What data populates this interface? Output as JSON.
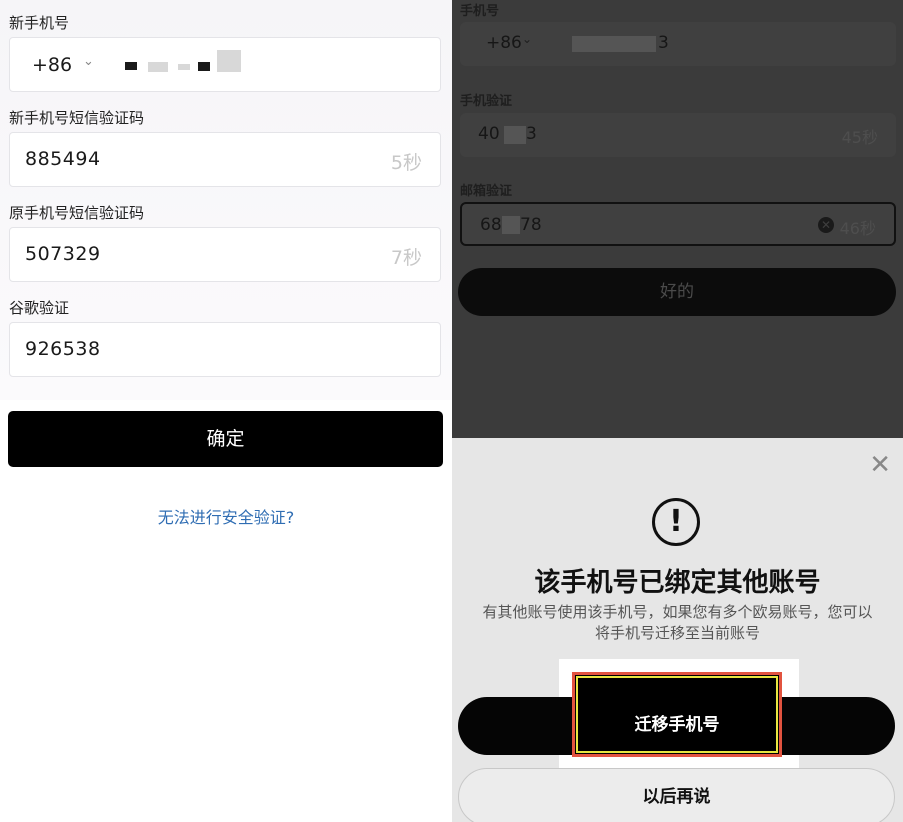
{
  "left": {
    "new_phone_label": "新手机号",
    "country_code": "+86",
    "new_sms_label": "新手机号短信验证码",
    "new_sms_value": "885494",
    "new_sms_timer": "5秒",
    "old_sms_label": "原手机号短信验证码",
    "old_sms_value": "507329",
    "old_sms_timer": "7秒",
    "google_label": "谷歌验证",
    "google_value": "926538",
    "confirm_label": "确定",
    "cant_verify_link": "无法进行安全验证?"
  },
  "right": {
    "phone_label": "手机号",
    "country_code": "+86",
    "phone_tail": "3",
    "phone_verify_label": "手机验证",
    "phone_verify_value": "40",
    "phone_verify_tail": "3",
    "phone_verify_timer": "45秒",
    "email_verify_label": "邮箱验证",
    "email_verify_value": "68",
    "email_verify_tail": "78",
    "email_verify_timer": "46秒",
    "ok_label": "好的",
    "sheet": {
      "title": "该手机号已绑定其他账号",
      "description": "有其他账号使用该手机号，如果您有多个欧易账号，您可以将手机号迁移至当前账号",
      "migrate_label": "迁移手机号",
      "later_label": "以后再说"
    }
  },
  "colors": {
    "primary_button": "#000000",
    "link": "#2f6db3",
    "highlight_box": "#e2533f",
    "highlight_inner": "#e8e640"
  },
  "icons": [
    "chevron-down-icon",
    "clear-icon",
    "close-icon",
    "alert-icon"
  ]
}
